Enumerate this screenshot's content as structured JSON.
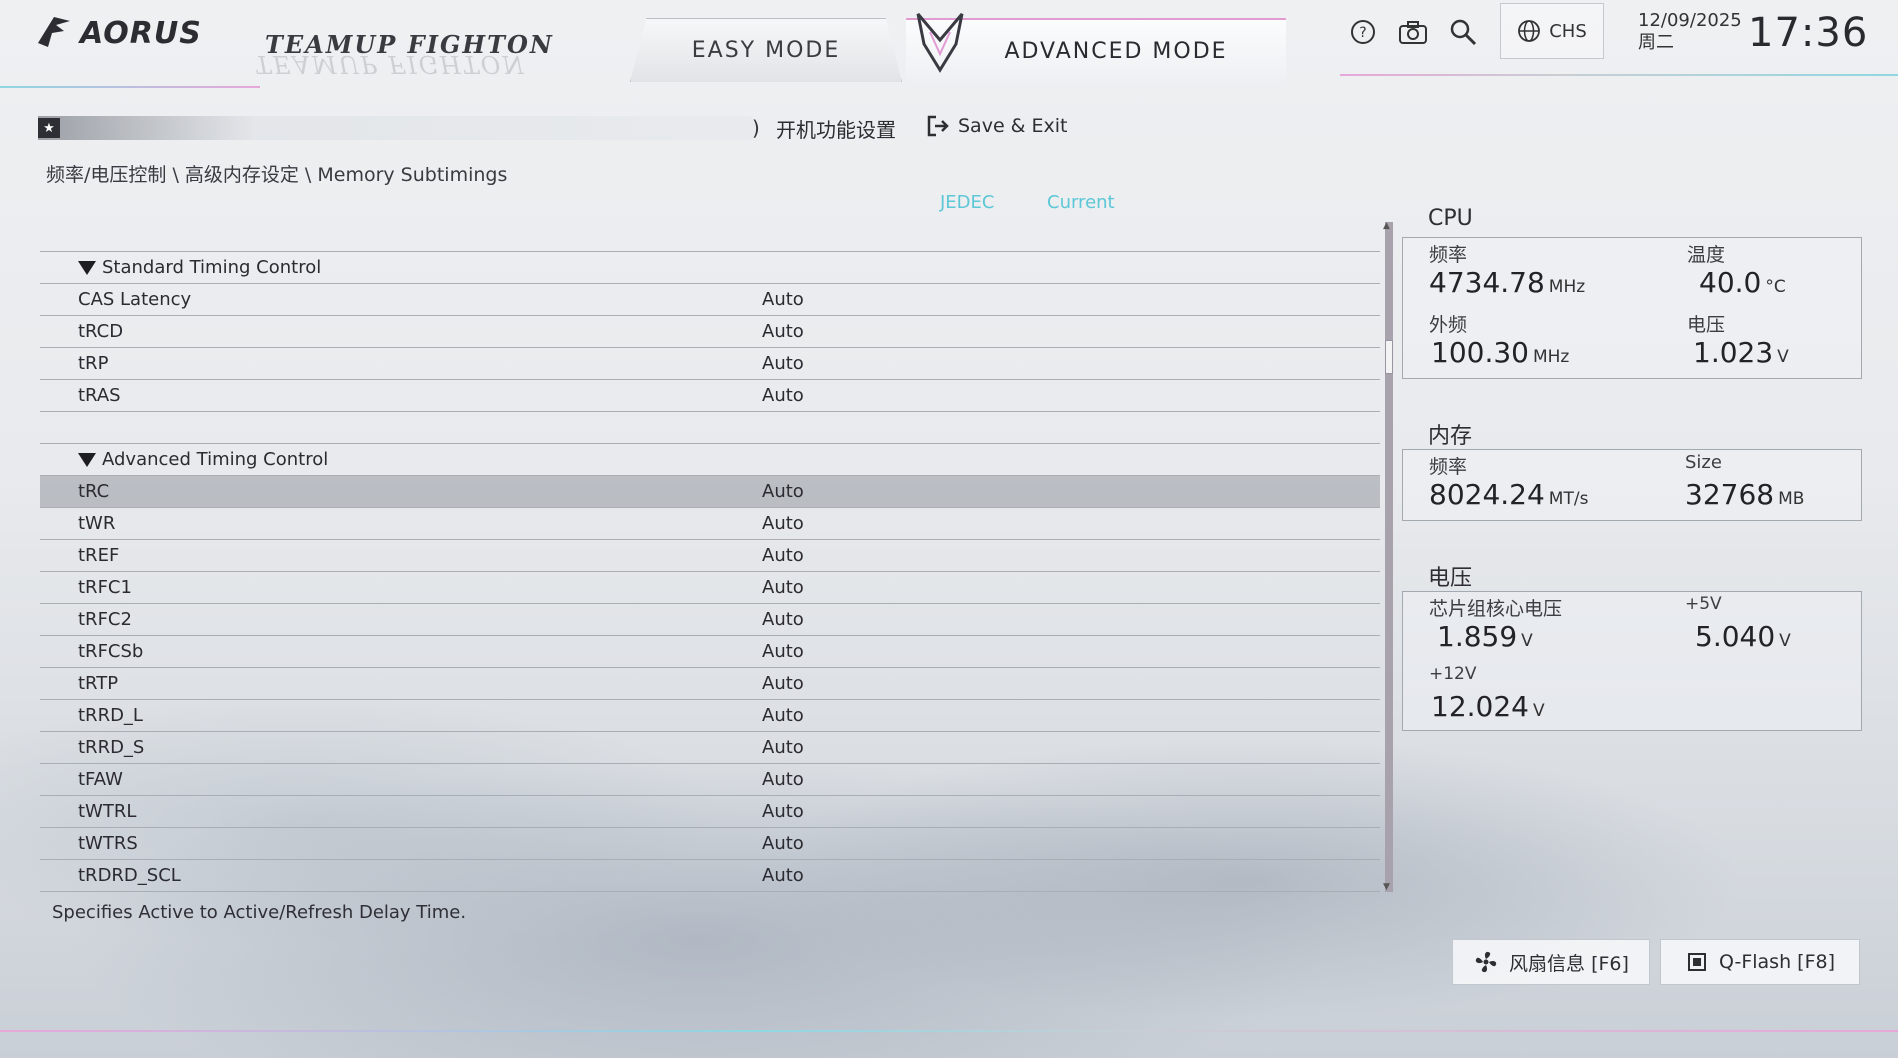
{
  "header": {
    "brand": "AORUS",
    "tagline": "TEAMUP FIGHTON",
    "tabs": [
      {
        "label": "EASY MODE",
        "active": false
      },
      {
        "label": "ADVANCED MODE",
        "active": true
      }
    ],
    "icons": [
      "help-icon",
      "camera-icon",
      "search-icon",
      "globe-icon"
    ],
    "language": "CHS",
    "date": "12/09/2025",
    "weekday": "周二",
    "time": "17:36"
  },
  "toolbar": {
    "boot_settings": "开机功能设置",
    "save_exit": "Save & Exit"
  },
  "breadcrumb": "频率/电压控制 \\ 高级内存设定 \\ Memory Subtimings",
  "columns": {
    "jedec": "JEDEC",
    "current": "Current"
  },
  "sections": [
    {
      "title": "Standard Timing Control",
      "rows": [
        {
          "name": "CAS Latency",
          "value": "Auto"
        },
        {
          "name": "tRCD",
          "value": "Auto"
        },
        {
          "name": "tRP",
          "value": "Auto"
        },
        {
          "name": "tRAS",
          "value": "Auto"
        }
      ]
    },
    {
      "title": "Advanced Timing Control",
      "rows": [
        {
          "name": "tRC",
          "value": "Auto",
          "selected": true
        },
        {
          "name": "tWR",
          "value": "Auto"
        },
        {
          "name": "tREF",
          "value": "Auto"
        },
        {
          "name": "tRFC1",
          "value": "Auto"
        },
        {
          "name": "tRFC2",
          "value": "Auto"
        },
        {
          "name": "tRFCSb",
          "value": "Auto"
        },
        {
          "name": "tRTP",
          "value": "Auto"
        },
        {
          "name": "tRRD_L",
          "value": "Auto"
        },
        {
          "name": "tRRD_S",
          "value": "Auto"
        },
        {
          "name": "tFAW",
          "value": "Auto"
        },
        {
          "name": "tWTRL",
          "value": "Auto"
        },
        {
          "name": "tWTRS",
          "value": "Auto"
        },
        {
          "name": "tRDRD_SCL",
          "value": "Auto"
        }
      ]
    }
  ],
  "help_text": "Specifies Active to Active/Refresh Delay Time.",
  "monitor": {
    "cpu": {
      "title": "CPU",
      "freq_label": "频率",
      "freq": "4734.78",
      "freq_unit": "MHz",
      "temp_label": "温度",
      "temp": "40.0",
      "temp_unit": "°C",
      "bclk_label": "外频",
      "bclk": "100.30",
      "bclk_unit": "MHz",
      "volt_label": "电压",
      "volt": "1.023",
      "volt_unit": "V"
    },
    "memory": {
      "title": "内存",
      "freq_label": "频率",
      "freq": "8024.24",
      "freq_unit": "MT/s",
      "size_label": "Size",
      "size": "32768",
      "size_unit": "MB"
    },
    "voltage": {
      "title": "电压",
      "chipset_label": "芯片组核心电压",
      "chipset": "1.859",
      "chipset_unit": "V",
      "v5_label": "+5V",
      "v5": "5.040",
      "v5_unit": "V",
      "v12_label": "+12V",
      "v12": "12.024",
      "v12_unit": "V"
    }
  },
  "footer": {
    "fan_button": "风扇信息 [F6]",
    "qflash_button": "Q-Flash [F8]"
  },
  "colors": {
    "accent_cyan": "#5cc7d6",
    "accent_pink": "#e29ad3",
    "selected_row": "#a3a7ae"
  }
}
